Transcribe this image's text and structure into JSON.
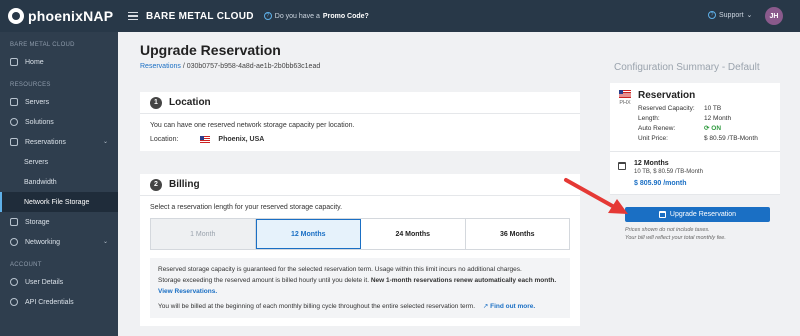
{
  "topbar": {
    "logo_text": "phoenixNAP",
    "product": "BARE METAL CLOUD",
    "promo_prefix": "Do you have a ",
    "promo_link": "Promo Code?",
    "support": "Support",
    "support_caret": "⌄",
    "avatar": "JH"
  },
  "sidebar": {
    "section1": "BARE METAL CLOUD",
    "home": "Home",
    "section2": "RESOURCES",
    "servers": "Servers",
    "solutions": "Solutions",
    "reservations": "Reservations",
    "res_servers": "Servers",
    "res_bandwidth": "Bandwidth",
    "res_nfs": "Network File Storage",
    "storage": "Storage",
    "networking": "Networking",
    "section3": "ACCOUNT",
    "user_details": "User Details",
    "api_credentials": "API Credentials"
  },
  "page": {
    "title": "Upgrade Reservation",
    "crumb_link": "Reservations",
    "crumb_sep": "/",
    "crumb_id": "030b0757-b958-4a8d-ae1b-2b0bb63c1ead"
  },
  "location": {
    "step": "1",
    "title": "Location",
    "text": "You can have one reserved network storage capacity per location.",
    "label": "Location:",
    "value": "Phoenix, USA"
  },
  "billing": {
    "step": "2",
    "title": "Billing",
    "text": "Select a reservation length for your reserved storage capacity.",
    "tabs": [
      "1 Month",
      "12 Months",
      "24 Months",
      "36 Months"
    ],
    "note_line1": "Reserved storage capacity is guaranteed for the selected reservation term. Usage within this limit incurs no additional charges.",
    "note_line2a": "Storage exceeding the reserved amount is billed hourly until you delete it. ",
    "note_line2b": "New 1-month reservations renew automatically each month.",
    "note_link": "View Reservations.",
    "note_line3": "You will be billed at the beginning of each monthly billing cycle throughout the entire selected reservation term.",
    "find_out": "Find out more."
  },
  "summary": {
    "title": "Configuration Summary - Default",
    "location_code": "PHX",
    "heading": "Reservation",
    "rows": [
      {
        "k": "Reserved Capacity:",
        "v": "10 TB"
      },
      {
        "k": "Length:",
        "v": "12 Month"
      },
      {
        "k": "Auto Renew:",
        "v": "ON"
      },
      {
        "k": "Unit Price:",
        "v": "$ 80.59 /TB-Month"
      }
    ],
    "plan_name": "12 Months",
    "plan_detail": "10 TB, $ 80.59 /TB-Month",
    "plan_price": "$ 805.90 /month",
    "button": "Upgrade Reservation",
    "fine1": "Prices shown do not include taxes.",
    "fine2": "Your bill will reflect your total monthly fee."
  },
  "colors": {
    "accent": "#1a6fc4",
    "annotation_arrow": "#e53935"
  }
}
